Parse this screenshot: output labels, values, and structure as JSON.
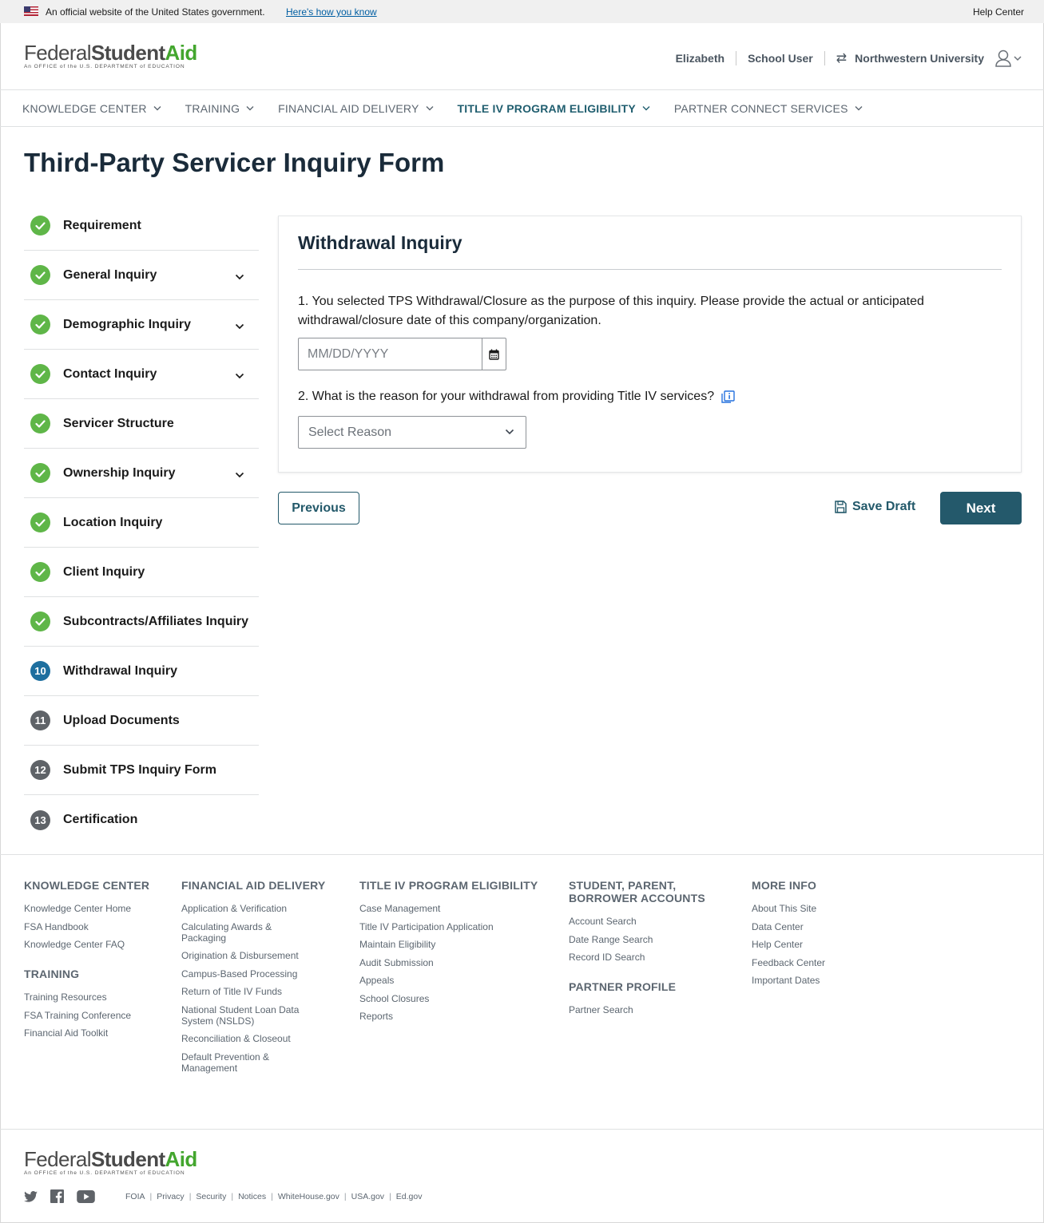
{
  "gov_banner": {
    "text": "An official website of the United States government.",
    "link": "Here's how you know",
    "help": "Help Center"
  },
  "logo": {
    "part1": "Federal",
    "part2": "Student",
    "part3": "Aid",
    "tagline": "An OFFICE of the U.S. DEPARTMENT of EDUCATION"
  },
  "user_nav": {
    "name": "Elizabeth",
    "role": "School User",
    "institution": "Northwestern University"
  },
  "main_nav": [
    {
      "label": "KNOWLEDGE CENTER",
      "active": false
    },
    {
      "label": "TRAINING",
      "active": false
    },
    {
      "label": "FINANCIAL AID DELIVERY",
      "active": false
    },
    {
      "label": "TITLE IV PROGRAM ELIGIBILITY",
      "active": true
    },
    {
      "label": "PARTNER CONNECT SERVICES",
      "active": false
    }
  ],
  "page_title": "Third-Party Servicer Inquiry Form",
  "steps": [
    {
      "label": "Requirement",
      "status": "done",
      "number": "1",
      "expandable": false
    },
    {
      "label": "General Inquiry",
      "status": "done",
      "number": "2",
      "expandable": true
    },
    {
      "label": "Demographic Inquiry",
      "status": "done",
      "number": "3",
      "expandable": true
    },
    {
      "label": "Contact Inquiry",
      "status": "done",
      "number": "4",
      "expandable": true
    },
    {
      "label": "Servicer Structure",
      "status": "done",
      "number": "5",
      "expandable": false
    },
    {
      "label": "Ownership Inquiry",
      "status": "done",
      "number": "6",
      "expandable": true
    },
    {
      "label": "Location Inquiry",
      "status": "done",
      "number": "7",
      "expandable": false
    },
    {
      "label": "Client Inquiry",
      "status": "done",
      "number": "8",
      "expandable": false
    },
    {
      "label": "Subcontracts/Affiliates Inquiry",
      "status": "done",
      "number": "9",
      "expandable": false
    },
    {
      "label": "Withdrawal Inquiry",
      "status": "current",
      "number": "10",
      "expandable": false
    },
    {
      "label": "Upload Documents",
      "status": "todo",
      "number": "11",
      "expandable": false
    },
    {
      "label": "Submit TPS Inquiry Form",
      "status": "todo",
      "number": "12",
      "expandable": false
    },
    {
      "label": "Certification",
      "status": "todo",
      "number": "13",
      "expandable": false
    }
  ],
  "form": {
    "title": "Withdrawal Inquiry",
    "q1": "1. You selected TPS Withdrawal/Closure as the purpose of this inquiry. Please provide the actual or anticipated withdrawal/closure date of this company/organization.",
    "date_placeholder": "MM/DD/YYYY",
    "date_value": "",
    "q2": "2. What is the reason for your withdrawal from providing Title IV services?",
    "select_value": "Select Reason"
  },
  "buttons": {
    "previous": "Previous",
    "save_draft": "Save Draft",
    "next": "Next"
  },
  "footer": {
    "knowledge_center": {
      "heading": "KNOWLEDGE CENTER",
      "links": [
        "Knowledge Center Home",
        "FSA Handbook",
        "Knowledge Center FAQ"
      ]
    },
    "training": {
      "heading": "TRAINING",
      "links": [
        "Training Resources",
        "FSA Training Conference",
        "Financial Aid Toolkit"
      ]
    },
    "financial_aid_delivery": {
      "heading": "FINANCIAL AID DELIVERY",
      "links": [
        "Application & Verification",
        "Calculating Awards & Packaging",
        "Origination & Disbursement",
        "Campus-Based Processing",
        "Return of Title IV Funds",
        "National Student Loan Data System (NSLDS)",
        "Reconciliation & Closeout",
        "Default Prevention & Management"
      ]
    },
    "title_iv": {
      "heading": "TITLE IV PROGRAM ELIGIBILITY",
      "links": [
        "Case Management",
        "Title IV Participation Application",
        "Maintain Eligibility",
        "Audit Submission",
        "Appeals",
        "School Closures",
        "Reports"
      ]
    },
    "accounts": {
      "heading": "STUDENT, PARENT, BORROWER ACCOUNTS",
      "links": [
        "Account Search",
        "Date Range Search",
        "Record ID Search"
      ]
    },
    "partner_profile": {
      "heading": "PARTNER PROFILE",
      "links": [
        "Partner Search"
      ]
    },
    "more_info": {
      "heading": "MORE INFO",
      "links": [
        "About This Site",
        "Data Center",
        "Help Center",
        "Feedback Center",
        "Important Dates"
      ]
    },
    "legal": [
      "FOIA",
      "Privacy",
      "Security",
      "Notices",
      "WhiteHouse.gov",
      "USA.gov",
      "Ed.gov"
    ],
    "social": [
      "twitter-icon",
      "facebook-icon",
      "youtube-icon"
    ]
  }
}
